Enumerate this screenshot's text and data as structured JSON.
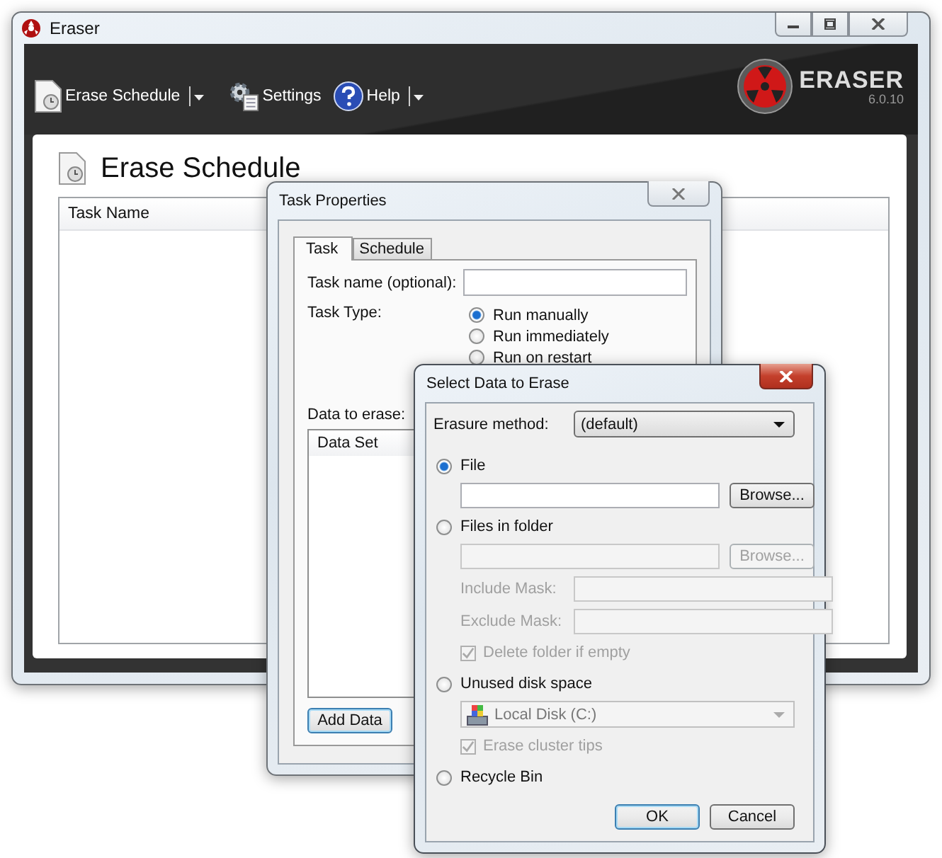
{
  "main_window": {
    "title": "Eraser",
    "toolbar": [
      {
        "label": "Erase Schedule",
        "kind": "schedule",
        "dropdown": true
      },
      {
        "label": "Settings",
        "kind": "settings",
        "dropdown": false
      },
      {
        "label": "Help",
        "kind": "help",
        "dropdown": true
      }
    ],
    "logo": {
      "name": "ERASER",
      "version": "6.0.10"
    },
    "page_title": "Erase Schedule",
    "table": {
      "columns": [
        "Task Name"
      ]
    }
  },
  "task_properties": {
    "title": "Task Properties",
    "tabs": [
      {
        "label": "Task",
        "selected": true
      },
      {
        "label": "Schedule",
        "selected": false
      }
    ],
    "task_name_label": "Task name (optional):",
    "task_type_label": "Task Type:",
    "task_types": [
      {
        "label": "Run manually",
        "selected": true
      },
      {
        "label": "Run immediately",
        "selected": false
      },
      {
        "label": "Run on restart",
        "selected": false
      }
    ],
    "data_label": "Data to erase:",
    "data_columns": [
      "Data Set"
    ],
    "add_button": "Add Data"
  },
  "select_data": {
    "title": "Select Data to Erase",
    "method_label": "Erasure method:",
    "method_value": "(default)",
    "sources": [
      {
        "kind": "file",
        "label": "File",
        "selected": true,
        "browse": "Browse...",
        "disabled": false
      },
      {
        "kind": "folder",
        "label": "Files in folder",
        "selected": false,
        "browse": "Browse...",
        "disabled": true,
        "include_label": "Include Mask:",
        "exclude_label": "Exclude Mask:",
        "checkbox": {
          "label": "Delete folder if empty",
          "checked": true
        }
      },
      {
        "kind": "disk",
        "label": "Unused disk space",
        "selected": false,
        "disabled": true,
        "drive": "Local Disk (C:)",
        "checkbox": {
          "label": "Erase cluster tips",
          "checked": true
        }
      },
      {
        "kind": "recycle",
        "label": "Recycle Bin",
        "selected": false
      }
    ],
    "buttons": [
      "OK",
      "Cancel"
    ]
  }
}
